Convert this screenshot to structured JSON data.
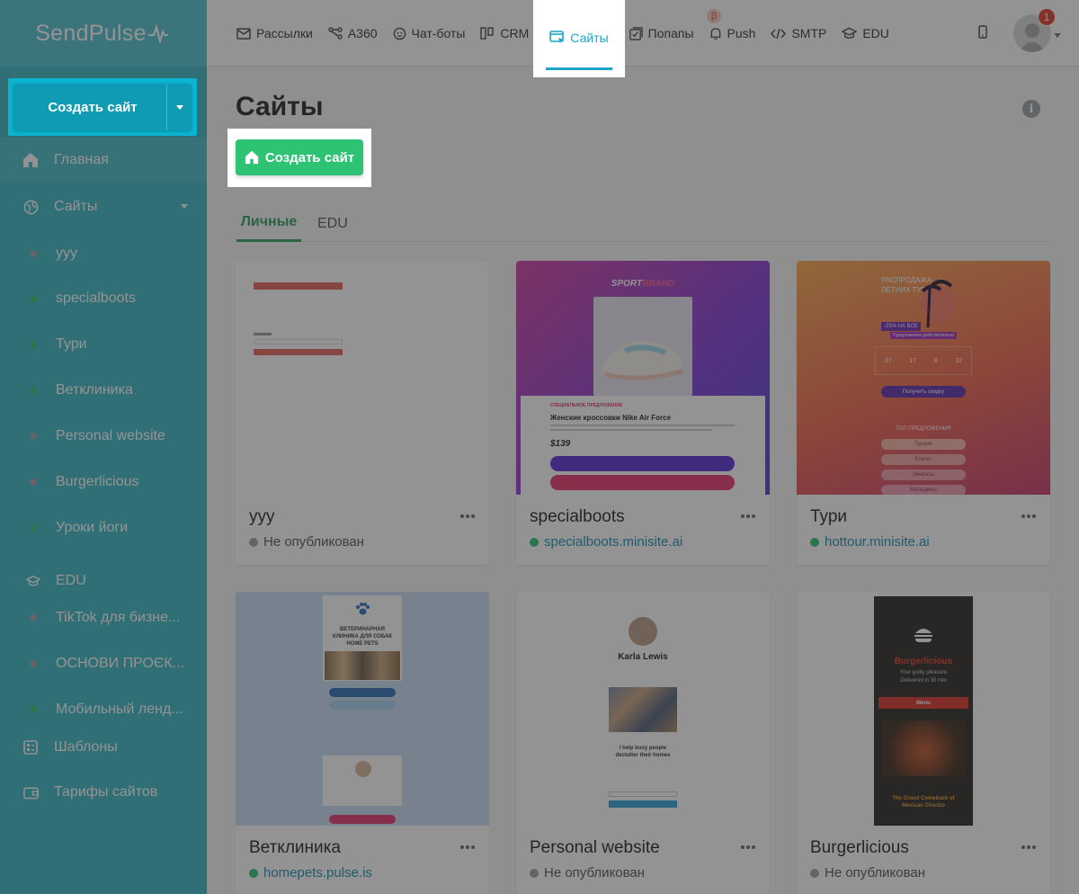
{
  "brand": {
    "name": "SendPulse"
  },
  "sidebar": {
    "create_label": "Создать сайт",
    "home": "Главная",
    "sites": "Сайты",
    "site_items": [
      {
        "label": "yyy",
        "color": "#9aa3a8"
      },
      {
        "label": "specialboots",
        "color": "#2ec275"
      },
      {
        "label": "Тури",
        "color": "#2ec275"
      },
      {
        "label": "Ветклиника",
        "color": "#2ec275"
      },
      {
        "label": "Personal website",
        "color": "#9aa3a8"
      },
      {
        "label": "Burgerlicious",
        "color": "#9aa3a8"
      },
      {
        "label": "Уроки йоги",
        "color": "#2ec275"
      }
    ],
    "edu_label": "EDU",
    "edu_items": [
      {
        "label": "TikTok для бизне...",
        "color": "#9aa3a8"
      },
      {
        "label": "ОСНОВИ ПРОЄК...",
        "color": "#9aa3a8"
      },
      {
        "label": "Мобильный ленд...",
        "color": "#2ec275"
      }
    ],
    "templates": "Шаблоны",
    "tariffs": "Тарифы сайтов"
  },
  "topnav": {
    "items": [
      "Рассылки",
      "A360",
      "Чат-боты",
      "CRM",
      "Сайты",
      "Попапы",
      "Push",
      "SMTP",
      "EDU"
    ],
    "active": "Сайты",
    "beta": "β",
    "notifications": "1"
  },
  "page": {
    "title": "Сайты",
    "info": "i",
    "create_button": "Создать сайт",
    "tabs": [
      "Личные",
      "EDU"
    ]
  },
  "cards": [
    {
      "name": "yyy",
      "status": "Не опубликован",
      "published": false
    },
    {
      "name": "specialboots",
      "status": "specialboots.minisite.ai",
      "published": true
    },
    {
      "name": "Тури",
      "status": "hottour.minisite.ai",
      "published": true
    },
    {
      "name": "Ветклиника",
      "status": "homepets.pulse.is",
      "published": true
    },
    {
      "name": "Personal website",
      "status": "Не опубликован",
      "published": false
    },
    {
      "name": "Burgerlicious",
      "status": "Не опубликован",
      "published": false
    }
  ],
  "thumbs": {
    "sport": {
      "brand": "SPORT",
      "brand_accent": "BRAND",
      "special": "СПЕЦИАЛЬНОЕ ПРЕДЛОЖЕНИЕ",
      "title": "Женские кроссовки Nike Air Force",
      "price": "$139"
    },
    "tour": {
      "headline": "РАСПРОДАЖА ЛЕТНИХ ТУРОВ!",
      "discount": "-25% НА ВСЕ",
      "tagline": "Предложение действительно",
      "countdown": [
        "27",
        "17",
        "8",
        "32"
      ],
      "cta": "Получить скидку",
      "top": "ТОП ПРЕДЛОЖЕНИЯ",
      "countries": [
        "Турция",
        "Египет",
        "Эмираты",
        "Мальдивы"
      ]
    },
    "vet": {
      "title": "ВЕТЕРИНАРНАЯ КЛИНИКА ДЛЯ СОБАК HOME PETS"
    },
    "personal": {
      "name": "Karla Lewis",
      "tagline": "I help busy people declutter their homes"
    },
    "burger": {
      "title": "Burgerlicious",
      "subtitle": "Your guilty pleasure",
      "delivery": "Delivered in 30 min",
      "menu": "Menu",
      "promo": "The Grand Comeback of Mexican Chorizo"
    }
  },
  "colors": {
    "brand": "#3bb6c7",
    "green": "#2ec275",
    "active": "#1ea4c8",
    "badge": "#e03b2c"
  }
}
